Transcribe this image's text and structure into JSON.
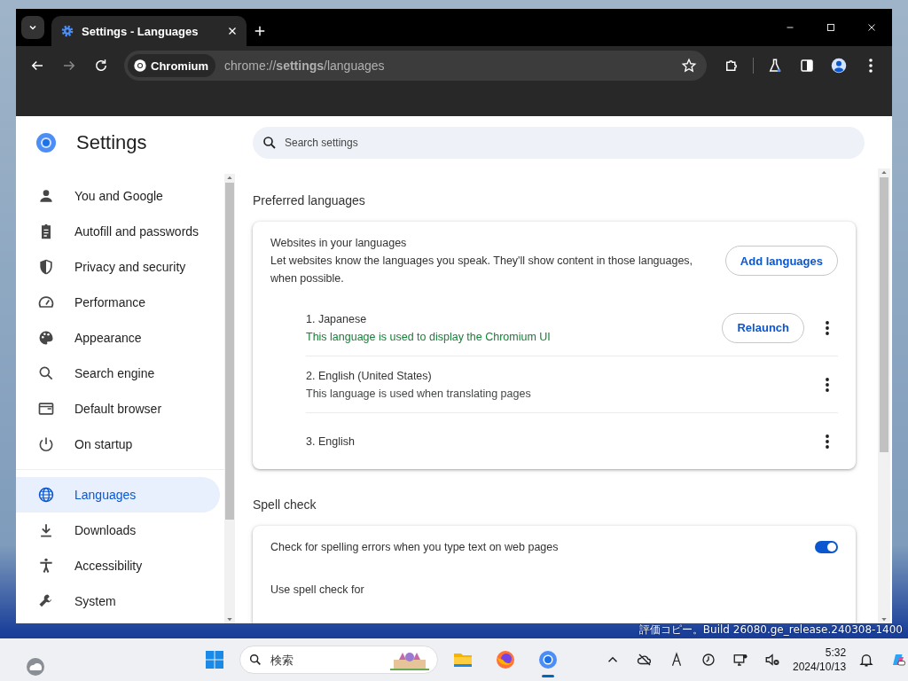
{
  "browser": {
    "tabs": [
      {
        "title": "Settings - Languages",
        "selected": true
      }
    ],
    "address": {
      "chip": "Chromium",
      "url": "chrome://**settings**/languages"
    }
  },
  "settings": {
    "title": "Settings",
    "search": {
      "placeholder": "Search settings"
    },
    "sidebar": {
      "groups": [
        {
          "items": [
            {
              "label": "You and Google",
              "selected": false
            },
            {
              "label": "Autofill and passwords",
              "selected": false
            },
            {
              "label": "Privacy and security",
              "selected": false
            },
            {
              "label": "Performance",
              "selected": false
            },
            {
              "label": "Appearance",
              "selected": false
            },
            {
              "label": "Search engine",
              "selected": false
            },
            {
              "label": "Default browser",
              "selected": false
            },
            {
              "label": "On startup",
              "selected": false
            }
          ]
        },
        {
          "items": [
            {
              "label": "Languages",
              "selected": true
            },
            {
              "label": "Downloads",
              "selected": false
            },
            {
              "label": "Accessibility",
              "selected": false
            },
            {
              "label": "System",
              "selected": false
            }
          ]
        }
      ]
    },
    "preferred": {
      "heading": "Preferred languages",
      "title": "Websites in your languages",
      "description": "Let websites know the languages you speak. They'll show content in those languages, when possible.",
      "button": "Add languages",
      "languages": [
        {
          "name": "1. Japanese",
          "note": {
            "text": "This language is used to display the Chromium UI",
            "color": "#188038"
          },
          "action": "Relaunch"
        },
        {
          "name": "2. English (United States)",
          "note": {
            "text": "This language is used when translating pages",
            "color": "#444746"
          }
        },
        {
          "name": "3. English"
        }
      ]
    },
    "spell_check": {
      "heading": "Spell check",
      "rows": [
        {
          "kind": "toggle",
          "label": "Check for spelling errors when you type text on web pages",
          "on": true
        },
        {
          "kind": "label",
          "label": "Use spell check for"
        }
      ]
    }
  },
  "desktop": {
    "watermark": "評価コピー。Build 26080.ge_release.240308-1400"
  },
  "taskbar": {
    "search": {
      "placeholder": "検索"
    },
    "time": "5:32",
    "date": "2024/10/13"
  }
}
